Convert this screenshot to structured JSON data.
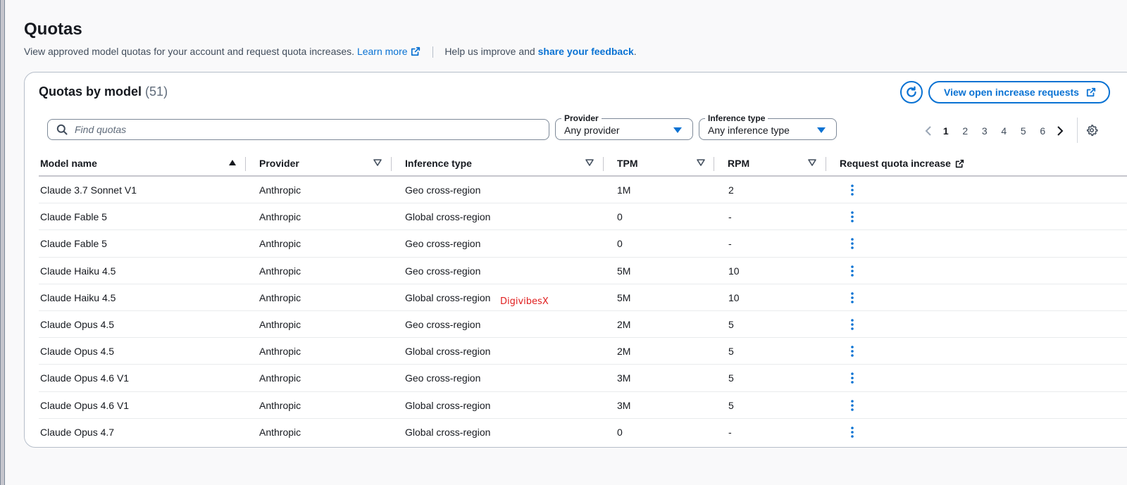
{
  "page": {
    "title": "Quotas",
    "description": "View approved model quotas for your account and request quota increases.",
    "learn_more": "Learn more",
    "help_text": "Help us improve and",
    "feedback_link": "share your feedback",
    "feedback_period": "."
  },
  "container": {
    "title": "Quotas by model",
    "count": "(51)",
    "view_requests_label": "View open increase requests"
  },
  "search": {
    "placeholder": "Find quotas"
  },
  "filters": {
    "provider": {
      "label": "Provider",
      "value": "Any provider"
    },
    "inference": {
      "label": "Inference type",
      "value": "Any inference type"
    }
  },
  "pagination": {
    "pages": [
      "1",
      "2",
      "3",
      "4",
      "5",
      "6"
    ],
    "current": "1"
  },
  "table": {
    "headers": {
      "model": "Model name",
      "provider": "Provider",
      "inference": "Inference type",
      "tpm": "TPM",
      "rpm": "RPM",
      "request": "Request quota increase"
    },
    "rows": [
      {
        "model": "Claude 3.7 Sonnet V1",
        "provider": "Anthropic",
        "inference": "Geo cross-region",
        "tpm": "1M",
        "rpm": "2"
      },
      {
        "model": "Claude Fable 5",
        "provider": "Anthropic",
        "inference": "Global cross-region",
        "tpm": "0",
        "rpm": "-"
      },
      {
        "model": "Claude Fable 5",
        "provider": "Anthropic",
        "inference": "Geo cross-region",
        "tpm": "0",
        "rpm": "-"
      },
      {
        "model": "Claude Haiku 4.5",
        "provider": "Anthropic",
        "inference": "Geo cross-region",
        "tpm": "5M",
        "rpm": "10"
      },
      {
        "model": "Claude Haiku 4.5",
        "provider": "Anthropic",
        "inference": "Global cross-region",
        "tpm": "5M",
        "rpm": "10"
      },
      {
        "model": "Claude Opus 4.5",
        "provider": "Anthropic",
        "inference": "Geo cross-region",
        "tpm": "2M",
        "rpm": "5"
      },
      {
        "model": "Claude Opus 4.5",
        "provider": "Anthropic",
        "inference": "Global cross-region",
        "tpm": "2M",
        "rpm": "5"
      },
      {
        "model": "Claude Opus 4.6 V1",
        "provider": "Anthropic",
        "inference": "Geo cross-region",
        "tpm": "3M",
        "rpm": "5"
      },
      {
        "model": "Claude Opus 4.6 V1",
        "provider": "Anthropic",
        "inference": "Global cross-region",
        "tpm": "3M",
        "rpm": "5"
      },
      {
        "model": "Claude Opus 4.7",
        "provider": "Anthropic",
        "inference": "Global cross-region",
        "tpm": "0",
        "rpm": "-"
      }
    ]
  },
  "watermark": "DigivibesX",
  "colors": {
    "link": "#0972d3",
    "text": "#16191f",
    "muted": "#5f6b7a",
    "border": "#b6bec9",
    "watermark": "#e02020"
  },
  "icons": [
    "external-link-icon",
    "refresh-icon",
    "search-icon",
    "caret-down-icon",
    "chevron-left-icon",
    "chevron-right-icon",
    "settings-icon",
    "sort-ascending-icon",
    "sort-icon",
    "more-actions-icon"
  ]
}
